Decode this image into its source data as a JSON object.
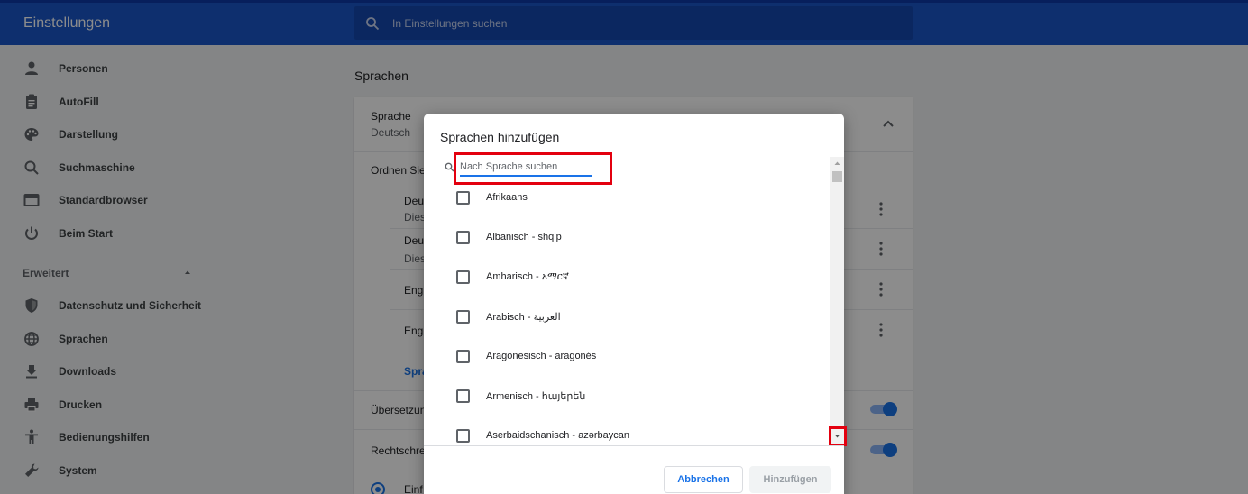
{
  "header": {
    "title": "Einstellungen",
    "search_placeholder": "In Einstellungen suchen"
  },
  "sidebar": {
    "items": [
      {
        "label": "Personen",
        "icon": "person-icon"
      },
      {
        "label": "AutoFill",
        "icon": "clipboard-icon"
      },
      {
        "label": "Darstellung",
        "icon": "palette-icon"
      },
      {
        "label": "Suchmaschine",
        "icon": "search-icon"
      },
      {
        "label": "Standardbrowser",
        "icon": "browser-icon"
      },
      {
        "label": "Beim Start",
        "icon": "power-icon"
      }
    ],
    "advanced_label": "Erweitert",
    "advanced_items": [
      {
        "label": "Datenschutz und Sicherheit",
        "icon": "shield-icon"
      },
      {
        "label": "Sprachen",
        "icon": "globe-icon"
      },
      {
        "label": "Downloads",
        "icon": "download-icon"
      },
      {
        "label": "Drucken",
        "icon": "printer-icon"
      },
      {
        "label": "Bedienungshilfen",
        "icon": "accessibility-icon"
      },
      {
        "label": "System",
        "icon": "wrench-icon"
      }
    ]
  },
  "main": {
    "section_title": "Sprachen",
    "language_label": "Sprache",
    "language_value": "Deutsch",
    "order_label": "Ordnen Sie",
    "languages": [
      {
        "line1": "Deu",
        "line2": "Dies"
      },
      {
        "line1": "Deu",
        "line2": "Dies"
      },
      {
        "line1": "Engl",
        "line2": ""
      },
      {
        "line1": "Engl",
        "line2": ""
      }
    ],
    "add_languages_link": "Spra",
    "translation_label": "Übersetzun",
    "spellcheck_label": "Rechtschrei",
    "radio_label": "Einf"
  },
  "dialog": {
    "title": "Sprachen hinzufügen",
    "search_placeholder": "Nach Sprache suchen",
    "languages": [
      "Afrikaans",
      "Albanisch - shqip",
      "Amharisch - አማርኛ",
      "Arabisch - العربية",
      "Aragonesisch - aragonés",
      "Armenisch - հայերեն",
      "Aserbaidschanisch - azərbaycan"
    ],
    "cancel_label": "Abbrechen",
    "add_label": "Hinzufügen"
  },
  "colors": {
    "header": "#1a57c9",
    "accent": "#1a73e8",
    "highlight": "#e3000f"
  }
}
